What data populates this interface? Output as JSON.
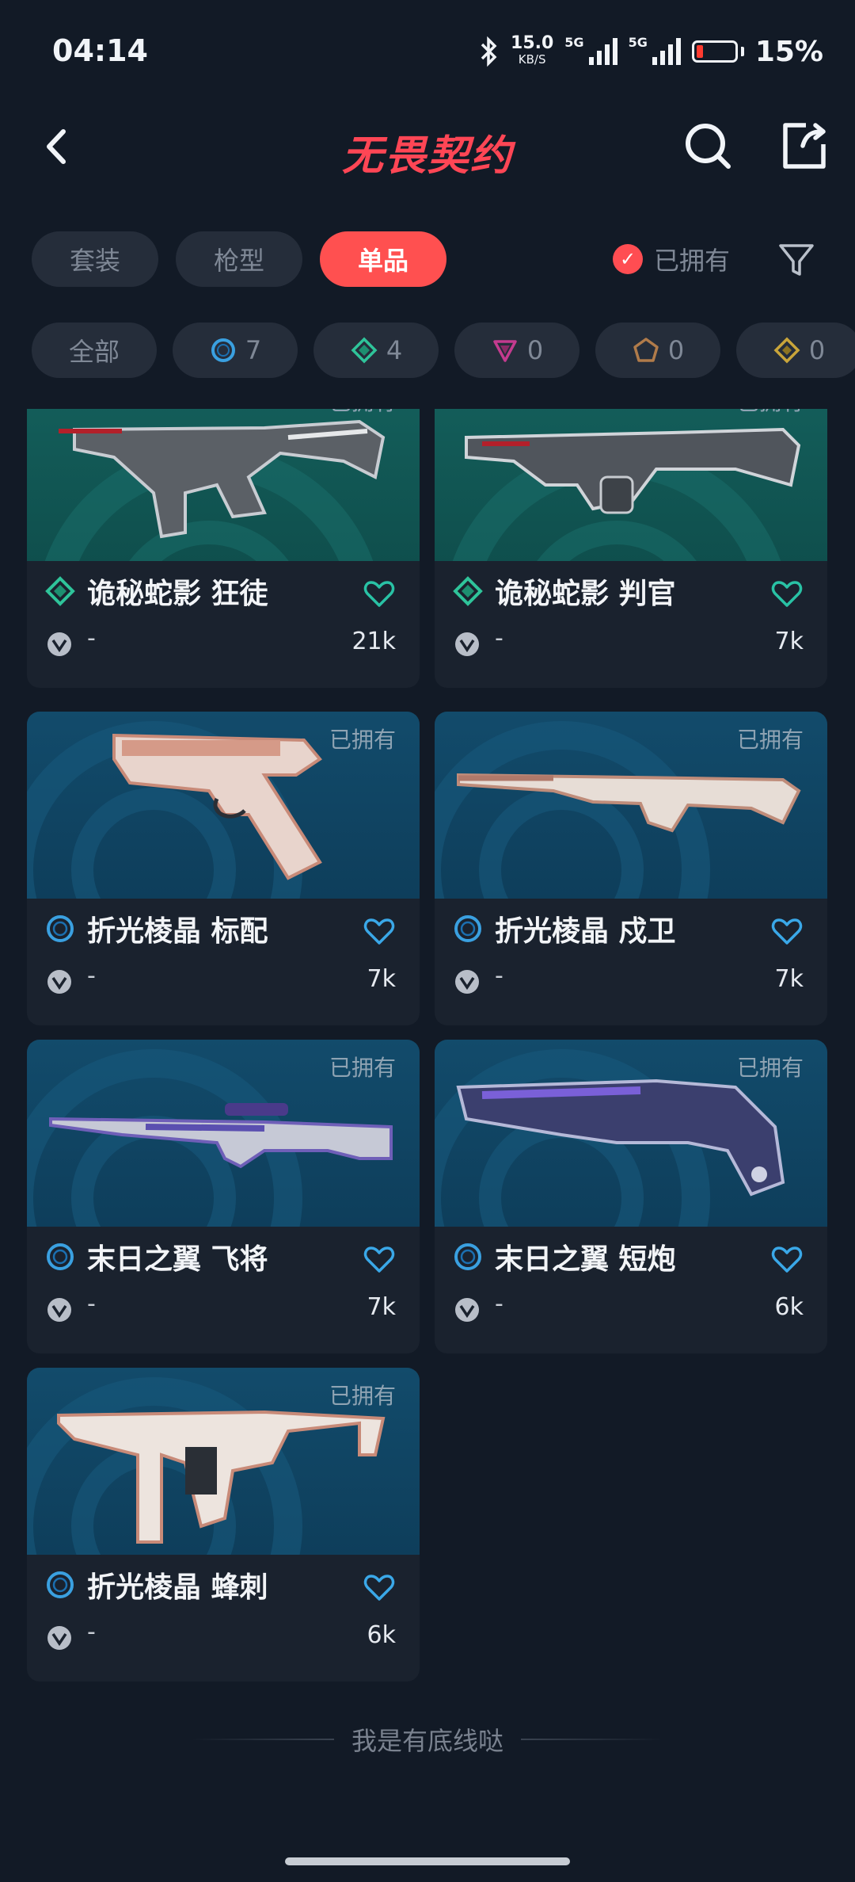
{
  "status": {
    "time": "04:14",
    "speed_value": "15.0",
    "speed_unit": "KB/S",
    "net1": "5G",
    "net2": "5G",
    "battery": "15%"
  },
  "header": {
    "title": "无畏契约",
    "back_icon": "chevron-left-icon",
    "search_icon": "search-icon",
    "share_icon": "share-icon"
  },
  "tabs": [
    {
      "label": "套装",
      "active": false
    },
    {
      "label": "枪型",
      "active": false
    },
    {
      "label": "单品",
      "active": true
    }
  ],
  "owned_filter": {
    "label": "已拥有",
    "checked": true
  },
  "chips": [
    {
      "label": "全部"
    },
    {
      "count": "7",
      "rarity": "blue-circle"
    },
    {
      "count": "4",
      "rarity": "green-diamond"
    },
    {
      "count": "0",
      "rarity": "purple-triangle"
    },
    {
      "count": "0",
      "rarity": "orange-pentagon"
    },
    {
      "count": "0",
      "rarity": "gold-diamond"
    }
  ],
  "cards": [
    {
      "name": "诡秘蛇影 狂徒",
      "owned": "已拥有",
      "price": "-",
      "likes": "21k",
      "rarity": "green-diamond",
      "bg": "teal"
    },
    {
      "name": "诡秘蛇影 判官",
      "owned": "已拥有",
      "price": "-",
      "likes": "7k",
      "rarity": "green-diamond",
      "bg": "teal"
    },
    {
      "name": "折光棱晶 标配",
      "owned": "已拥有",
      "price": "-",
      "likes": "7k",
      "rarity": "blue-circle",
      "bg": "blue"
    },
    {
      "name": "折光棱晶 戍卫",
      "owned": "已拥有",
      "price": "-",
      "likes": "7k",
      "rarity": "blue-circle",
      "bg": "blue"
    },
    {
      "name": "末日之翼 飞将",
      "owned": "已拥有",
      "price": "-",
      "likes": "7k",
      "rarity": "blue-circle",
      "bg": "blue"
    },
    {
      "name": "末日之翼 短炮",
      "owned": "已拥有",
      "price": "-",
      "likes": "6k",
      "rarity": "blue-circle",
      "bg": "blue"
    },
    {
      "name": "折光棱晶 蜂刺",
      "owned": "已拥有",
      "price": "-",
      "likes": "6k",
      "rarity": "blue-circle",
      "bg": "blue"
    }
  ],
  "footer_text": "我是有底线哒",
  "colors": {
    "background": "#121a26",
    "accent": "#ff5050",
    "title": "#ff4655",
    "rarity_blue": "#3aa0e0",
    "rarity_green": "#2fc49a",
    "heart_teal": "#29c2a5",
    "heart_blue": "#3aa8e8"
  }
}
